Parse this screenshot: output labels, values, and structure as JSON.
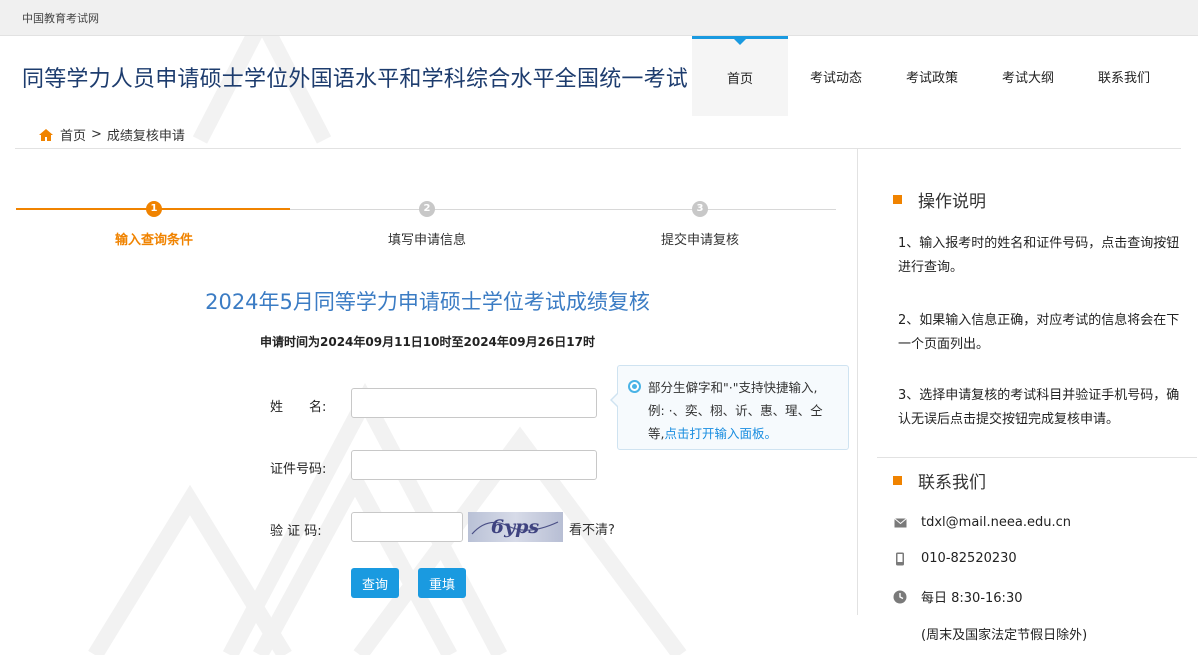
{
  "topbar": {
    "link": "中国教育考试网"
  },
  "header": {
    "title": "同等学力人员申请硕士学位外国语水平和学科综合水平全国统一考试",
    "nav": [
      "首页",
      "考试动态",
      "考试政策",
      "考试大纲",
      "联系我们"
    ]
  },
  "breadcrumb": {
    "home": "首页",
    "separator": ">",
    "current": "成绩复核申请"
  },
  "steps": [
    {
      "num": "1",
      "label": "输入查询条件"
    },
    {
      "num": "2",
      "label": "填写申请信息"
    },
    {
      "num": "3",
      "label": "提交申请复核"
    }
  ],
  "main": {
    "title": "2024年5月同等学力申请硕士学位考试成绩复核",
    "time": "申请时间为2024年09月11日10时至2024年09月26日17时"
  },
  "form": {
    "name_label": "姓　　名:",
    "id_label": "证件号码:",
    "captcha_label": "验 证 码:",
    "captcha_text": "6yps",
    "captcha_refresh": "看不清?",
    "query_button": "查询",
    "reset_button": "重填"
  },
  "tip": {
    "text1": "部分生僻字和\"·\"支持快捷输入,",
    "text2": "例: ·、奕、栩、䜣、惠、瑆、仝",
    "text3": "等,",
    "link": "点击打开输入面板。"
  },
  "sidebar": {
    "instructions_title": "操作说明",
    "instructions": [
      "1、输入报考时的姓名和证件号码，点击查询按钮进行查询。",
      "2、如果输入信息正确，对应考试的信息将会在下一个页面列出。",
      "3、选择申请复核的考试科目并验证手机号码，确认无误后点击提交按钮完成复核申请。"
    ],
    "contact_title": "联系我们",
    "email": "tdxl@mail.neea.edu.cn",
    "phone": "010-82520230",
    "hours": "每日 8:30-16:30",
    "hours_note": "(周末及国家法定节假日除外)"
  },
  "colors": {
    "accent_blue": "#1a9ae0",
    "accent_orange": "#f08300",
    "title_blue": "#3b7cc4",
    "header_navy": "#1d3c6e"
  }
}
